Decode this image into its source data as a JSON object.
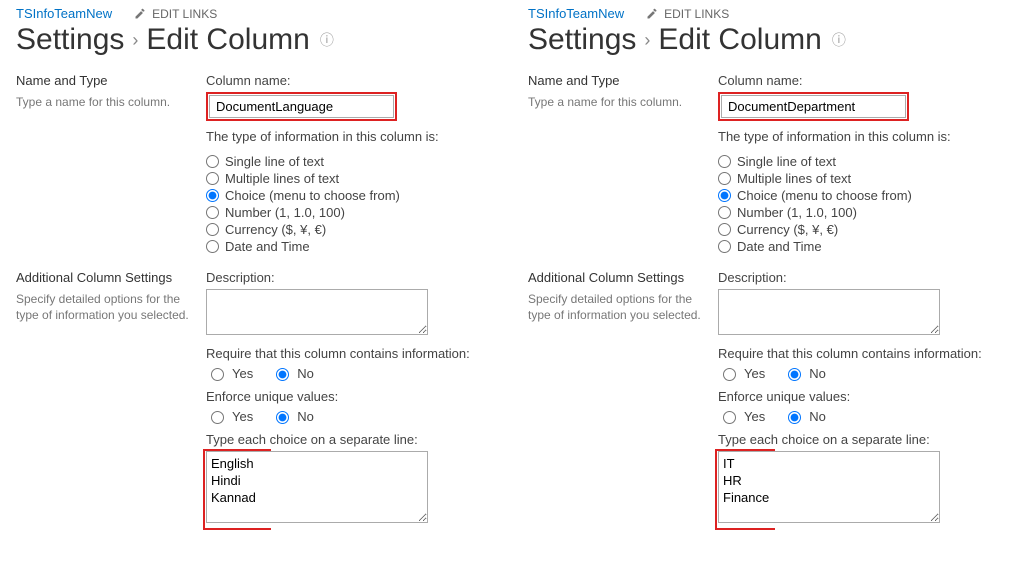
{
  "left": {
    "site_link": "TSInfoTeamNew",
    "edit_links": "EDIT LINKS",
    "breadcrumb": {
      "settings": "Settings",
      "page": "Edit Column"
    },
    "name_type": {
      "heading": "Name and Type",
      "sub": "Type a name for this column.",
      "col_label": "Column name:",
      "col_value": "DocumentLanguage",
      "type_label": "The type of information in this column is:",
      "types": [
        "Single line of text",
        "Multiple lines of text",
        "Choice (menu to choose from)",
        "Number (1, 1.0, 100)",
        "Currency ($, ¥, €)",
        "Date and Time"
      ]
    },
    "additional": {
      "heading": "Additional Column Settings",
      "sub": "Specify detailed options for the type of information you selected.",
      "desc_label": "Description:",
      "require_label": "Require that this column contains information:",
      "yes": "Yes",
      "no": "No",
      "unique_label": "Enforce unique values:",
      "choices_label": "Type each choice on a separate line:",
      "choices_value": "English\nHindi\nKannad"
    }
  },
  "right": {
    "site_link": "TSInfoTeamNew",
    "edit_links": "EDIT LINKS",
    "breadcrumb": {
      "settings": "Settings",
      "page": "Edit Column"
    },
    "name_type": {
      "heading": "Name and Type",
      "sub": "Type a name for this column.",
      "col_label": "Column name:",
      "col_value": "DocumentDepartment",
      "type_label": "The type of information in this column is:",
      "types": [
        "Single line of text",
        "Multiple lines of text",
        "Choice (menu to choose from)",
        "Number (1, 1.0, 100)",
        "Currency ($, ¥, €)",
        "Date and Time"
      ]
    },
    "additional": {
      "heading": "Additional Column Settings",
      "sub": "Specify detailed options for the type of information you selected.",
      "desc_label": "Description:",
      "require_label": "Require that this column contains information:",
      "yes": "Yes",
      "no": "No",
      "unique_label": "Enforce unique values:",
      "choices_label": "Type each choice on a separate line:",
      "choices_value": "IT\nHR\nFinance"
    }
  }
}
